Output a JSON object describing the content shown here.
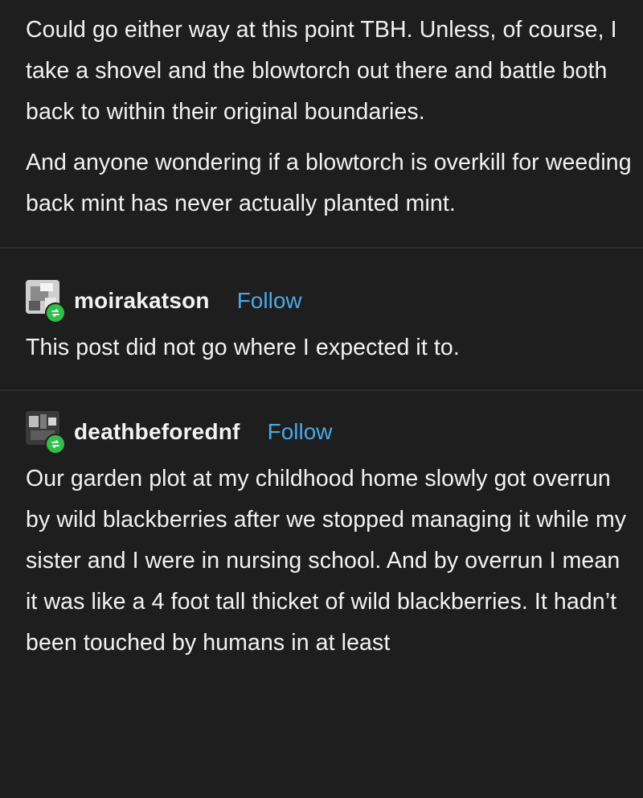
{
  "post_top": {
    "paragraphs": [
      "Could go either way at this point TBH. Unless, of course, I take a shovel and the blowtorch out there and battle both back to within their original boundaries.",
      "And anyone wondering if a blowtorch is overkill for weeding back mint has never actually planted mint."
    ]
  },
  "reblogs": [
    {
      "username": "moirakatson",
      "follow_label": "Follow",
      "text": "This post did not go where I expected it to."
    },
    {
      "username": "deathbeforednf",
      "follow_label": "Follow",
      "text": "Our garden plot at my childhood home slowly got overrun by wild blackberries after we stopped managing it while my sister and I were in nursing school. And by overrun I mean it was like a 4 foot tall thicket of wild blackberries. It hadn’t been touched by humans in at least"
    }
  ],
  "colors": {
    "background": "#1e1e1e",
    "text": "#f2f2f2",
    "follow": "#4aa8e8",
    "reblog_badge": "#2fbf4a"
  }
}
